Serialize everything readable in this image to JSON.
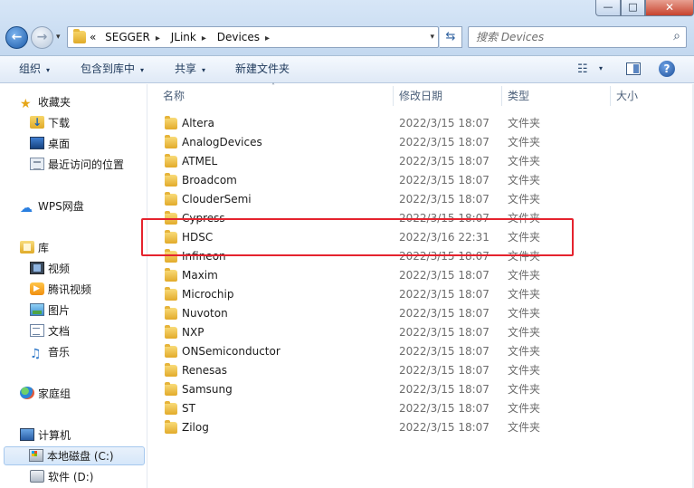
{
  "window": {
    "minimize_glyph": "—",
    "maximize_glyph": "□",
    "close_glyph": "✕"
  },
  "nav_buttons": {
    "back_glyph": "←",
    "forward_glyph": "→",
    "history_glyph": "▾"
  },
  "address": {
    "overflow": "«",
    "crumbs": [
      "SEGGER",
      "JLink",
      "Devices"
    ],
    "separator": "▸",
    "dropdown_glyph": "▾",
    "refresh_glyph": "⇆"
  },
  "search": {
    "placeholder": "搜索 Devices",
    "icon": "search-icon"
  },
  "toolbar": {
    "organize": "组织",
    "include_in_library": "包含到库中",
    "share": "共享",
    "new_folder": "新建文件夹",
    "caret": "▾",
    "view_glyph": "☷",
    "help_glyph": "?"
  },
  "nav": {
    "favorites": "收藏夹",
    "downloads": "下载",
    "desktop": "桌面",
    "recent": "最近访问的位置",
    "wps": "WPS网盘",
    "libraries": "库",
    "videos": "视频",
    "tencent_video": "腾讯视频",
    "pictures": "图片",
    "documents": "文档",
    "music": "音乐",
    "homegroup": "家庭组",
    "computer": "计算机",
    "drive_c": "本地磁盘 (C:)",
    "drive_d": "软件 (D:)",
    "star_glyph": "★",
    "cloud_glyph": "☁",
    "music_glyph": "♫"
  },
  "columns": {
    "name": "名称",
    "modified": "修改日期",
    "type": "类型",
    "size": "大小",
    "sort_glyph": "˄"
  },
  "files": [
    {
      "name": "Altera",
      "date": "2022/3/15 18:07",
      "type": "文件夹"
    },
    {
      "name": "AnalogDevices",
      "date": "2022/3/15 18:07",
      "type": "文件夹"
    },
    {
      "name": "ATMEL",
      "date": "2022/3/15 18:07",
      "type": "文件夹"
    },
    {
      "name": "Broadcom",
      "date": "2022/3/15 18:07",
      "type": "文件夹"
    },
    {
      "name": "ClouderSemi",
      "date": "2022/3/15 18:07",
      "type": "文件夹"
    },
    {
      "name": "Cypress",
      "date": "2022/3/15 18:07",
      "type": "文件夹"
    },
    {
      "name": "HDSC",
      "date": "2022/3/16 22:31",
      "type": "文件夹"
    },
    {
      "name": "Infineon",
      "date": "2022/3/15 18:07",
      "type": "文件夹"
    },
    {
      "name": "Maxim",
      "date": "2022/3/15 18:07",
      "type": "文件夹"
    },
    {
      "name": "Microchip",
      "date": "2022/3/15 18:07",
      "type": "文件夹"
    },
    {
      "name": "Nuvoton",
      "date": "2022/3/15 18:07",
      "type": "文件夹"
    },
    {
      "name": "NXP",
      "date": "2022/3/15 18:07",
      "type": "文件夹"
    },
    {
      "name": "ONSemiconductor",
      "date": "2022/3/15 18:07",
      "type": "文件夹"
    },
    {
      "name": "Renesas",
      "date": "2022/3/15 18:07",
      "type": "文件夹"
    },
    {
      "name": "Samsung",
      "date": "2022/3/15 18:07",
      "type": "文件夹"
    },
    {
      "name": "ST",
      "date": "2022/3/15 18:07",
      "type": "文件夹"
    },
    {
      "name": "Zilog",
      "date": "2022/3/15 18:07",
      "type": "文件夹"
    }
  ],
  "colors": {
    "highlight_box": "#e5232e",
    "folder": "#e2aa2a",
    "address_bar": "#c3d8ef"
  }
}
